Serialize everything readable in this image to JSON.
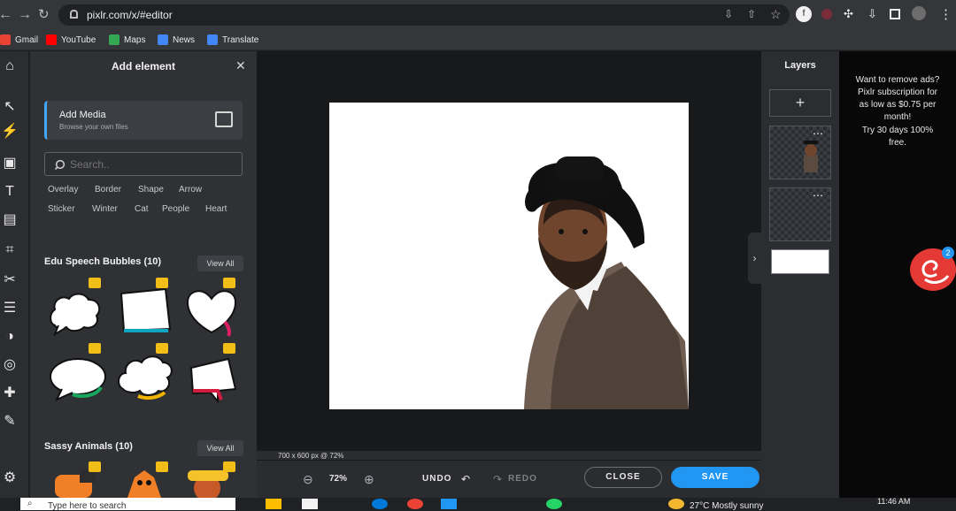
{
  "browser": {
    "url": "pixlr.com/x/#editor",
    "bookmarks": [
      "Gmail",
      "YouTube",
      "Maps",
      "News",
      "Translate"
    ]
  },
  "panel": {
    "title": "Add element",
    "media_title": "Add Media",
    "media_subtitle": "Browse your own files",
    "search_placeholder": "Search..",
    "tags": [
      "Overlay",
      "Border",
      "Shape",
      "Arrow",
      "Sticker",
      "Winter",
      "Cat",
      "People",
      "Heart"
    ],
    "section1": "Edu Speech Bubbles (10)",
    "section2": "Sassy Animals (10)",
    "view_all": "View All"
  },
  "canvas": {
    "status": "700 x 600 px @ 72%",
    "zoom": "72%",
    "undo": "UNDO",
    "redo": "REDO",
    "close": "CLOSE",
    "save": "SAVE"
  },
  "layers": {
    "title": "Layers",
    "add": "+"
  },
  "ad": {
    "text1": "Want to remove ads?",
    "text2": "Pixlr subscription for",
    "text3": "as low as $0.75 per",
    "text4": "month!",
    "text5": "Try 30 days 100%",
    "text6": "free.",
    "badge": "2"
  },
  "taskbar": {
    "search": "Type here to search",
    "weather": "27°C  Mostly sunny",
    "time": "11:46 AM"
  },
  "colors": {
    "accent_blue": "#2196f3",
    "panel_dark": "#2f3134",
    "crown_yellow": "#f1be18"
  }
}
